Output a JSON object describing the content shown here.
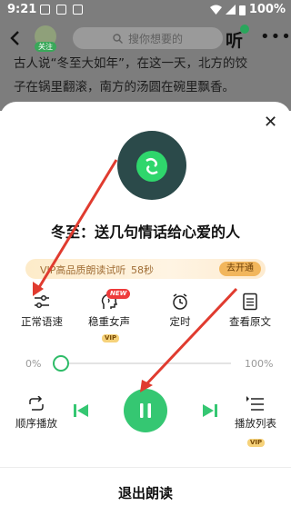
{
  "status_bar": {
    "time": "9:21",
    "battery": "100%"
  },
  "header": {
    "search_placeholder": "搜你想要的",
    "follow_label": "关注",
    "listen_label": "听"
  },
  "article": {
    "line1": "古人说“冬至大如年”，在这一天，北方的饺",
    "line2": "子在锅里翻滚，南方的汤圆在碗里飘香。"
  },
  "sheet": {
    "title": "冬至：送几句情话给心爱的人",
    "vip_promo": {
      "text": "VIP高品质朗读试听",
      "countdown": "58秒",
      "button": "去开通"
    },
    "controls": [
      {
        "label": "正常语速",
        "icon": "speed-sliders-icon"
      },
      {
        "label": "稳重女声",
        "icon": "voice-head-icon",
        "badge_new": "NEW",
        "badge_vip": "VIP"
      },
      {
        "label": "定时",
        "icon": "alarm-clock-icon"
      },
      {
        "label": "查看原文",
        "icon": "document-icon"
      }
    ],
    "progress": {
      "start_label": "0%",
      "end_label": "100%",
      "value_percent": 0
    },
    "playback": {
      "mode_label": "顺序播放",
      "playlist_label": "播放列表",
      "playlist_vip": "VIP"
    },
    "exit_label": "退出朗读"
  },
  "colors": {
    "accent_green": "#35c772",
    "overlay_gray": "#7d7d7d",
    "arrow_red": "#e03b2f",
    "vip_text": "#a06d35"
  }
}
